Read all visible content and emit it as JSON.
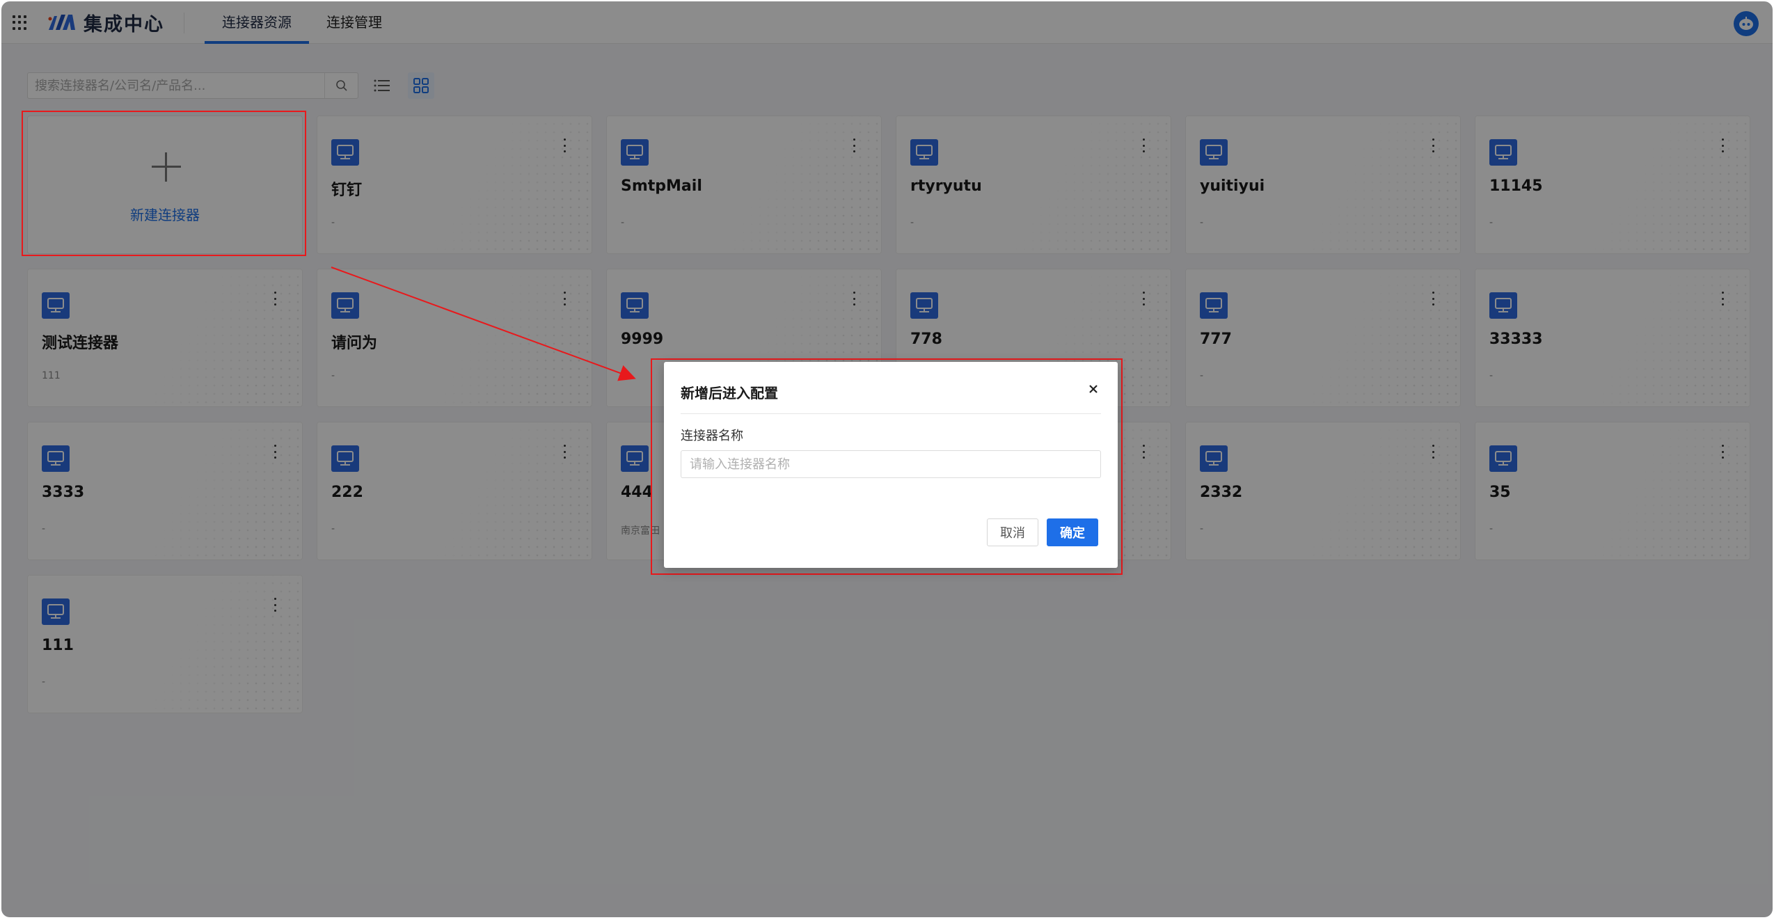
{
  "header": {
    "app_title": "集成中心",
    "tabs": [
      {
        "label": "连接器资源",
        "active": true
      },
      {
        "label": "连接管理",
        "active": false
      }
    ]
  },
  "toolbar": {
    "search_placeholder": "搜索连接器名/公司名/产品名...",
    "view_modes": [
      "list",
      "grid"
    ],
    "active_view": "grid"
  },
  "new_card": {
    "label": "新建连接器"
  },
  "cards": [
    {
      "title": "钉钉",
      "sub": "-"
    },
    {
      "title": "SmtpMail",
      "sub": "-"
    },
    {
      "title": "rtyryutu",
      "sub": "-"
    },
    {
      "title": "yuitiyui",
      "sub": "-"
    },
    {
      "title": "11145",
      "sub": "-"
    },
    {
      "title": "测试连接器",
      "sub": "111"
    },
    {
      "title": "请问为",
      "sub": "-"
    },
    {
      "title": "9999",
      "sub": "-"
    },
    {
      "title": "778",
      "sub": "-"
    },
    {
      "title": "777",
      "sub": "-"
    },
    {
      "title": "33333",
      "sub": "-"
    },
    {
      "title": "3333",
      "sub": "-"
    },
    {
      "title": "222",
      "sub": "-"
    },
    {
      "title": "444",
      "sub": "南京富田"
    },
    {
      "title": "",
      "sub": "-"
    },
    {
      "title": "2332",
      "sub": "-"
    },
    {
      "title": "35",
      "sub": "-"
    },
    {
      "title": "111",
      "sub": "-"
    }
  ],
  "modal": {
    "title": "新增后进入配置",
    "field_label": "连接器名称",
    "field_placeholder": "请输入连接器名称",
    "cancel_label": "取消",
    "ok_label": "确定"
  },
  "colors": {
    "accent": "#1e6fe8",
    "annotation": "#e8191c",
    "icon_bg": "#2f6ae0"
  }
}
